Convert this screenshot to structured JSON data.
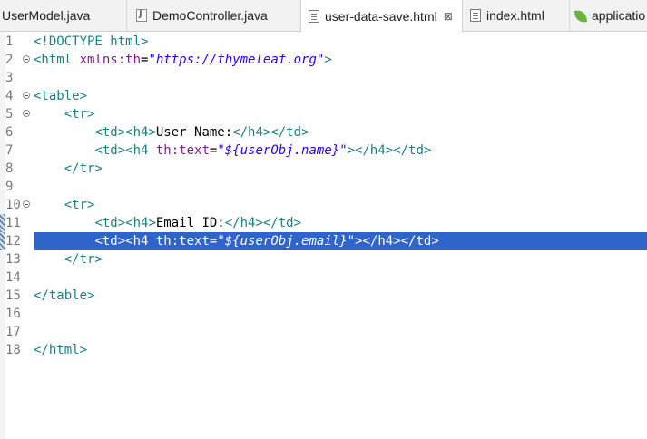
{
  "tabs": [
    {
      "label": "UserModel.java",
      "icon": "java-file-icon"
    },
    {
      "label": "DemoController.java",
      "icon": "java-file-icon"
    },
    {
      "label": "user-data-save.html",
      "icon": "html-file-icon",
      "active": true,
      "close": "⊠"
    },
    {
      "label": "index.html",
      "icon": "html-file-icon"
    },
    {
      "label": "applicatio",
      "icon": "spring-leaf-icon"
    }
  ],
  "editor": {
    "lines": [
      {
        "num": "1",
        "tokens": [
          [
            "tag",
            "<!DOCTYPE html>"
          ]
        ]
      },
      {
        "num": "2",
        "fold": true,
        "tokens": [
          [
            "tag",
            "<html "
          ],
          [
            "attr",
            "xmlns:th"
          ],
          [
            "txt",
            "="
          ],
          [
            "val",
            "\"https://thymeleaf.org\""
          ],
          [
            "tag",
            ">"
          ]
        ]
      },
      {
        "num": "3",
        "tokens": []
      },
      {
        "num": "4",
        "fold": true,
        "tokens": [
          [
            "tag",
            "<table>"
          ]
        ]
      },
      {
        "num": "5",
        "fold": true,
        "tokens": [
          [
            "txt",
            "    "
          ],
          [
            "tag",
            "<tr>"
          ]
        ]
      },
      {
        "num": "6",
        "tokens": [
          [
            "txt",
            "        "
          ],
          [
            "tag",
            "<td><h4>"
          ],
          [
            "txt",
            "User Name:"
          ],
          [
            "tag",
            "</h4></td>"
          ]
        ]
      },
      {
        "num": "7",
        "tokens": [
          [
            "txt",
            "        "
          ],
          [
            "tag",
            "<td><h4 "
          ],
          [
            "attr",
            "th:text"
          ],
          [
            "txt",
            "="
          ],
          [
            "val",
            "\"${userObj.name}\""
          ],
          [
            "tag",
            "></h4></td>"
          ]
        ]
      },
      {
        "num": "8",
        "tokens": [
          [
            "txt",
            "    "
          ],
          [
            "tag",
            "</tr>"
          ]
        ]
      },
      {
        "num": "9",
        "tokens": []
      },
      {
        "num": "10",
        "fold": true,
        "tokens": [
          [
            "txt",
            "    "
          ],
          [
            "tag",
            "<tr>"
          ]
        ]
      },
      {
        "num": "11",
        "marker": true,
        "tokens": [
          [
            "txt",
            "        "
          ],
          [
            "tag",
            "<td><h4>"
          ],
          [
            "txt",
            "Email ID:"
          ],
          [
            "tag",
            "</h4></td>"
          ]
        ]
      },
      {
        "num": "12",
        "marker": true,
        "selected": true,
        "tokens": [
          [
            "txt",
            "        "
          ],
          [
            "tag",
            "<td><h4 "
          ],
          [
            "attr",
            "th:text"
          ],
          [
            "txt",
            "="
          ],
          [
            "val",
            "\"${userObj.email}\""
          ],
          [
            "tag",
            "></h4></td>"
          ]
        ]
      },
      {
        "num": "13",
        "tokens": [
          [
            "txt",
            "    "
          ],
          [
            "tag",
            "</tr>"
          ]
        ]
      },
      {
        "num": "14",
        "tokens": []
      },
      {
        "num": "15",
        "tokens": [
          [
            "tag",
            "</table>"
          ]
        ]
      },
      {
        "num": "16",
        "tokens": []
      },
      {
        "num": "17",
        "tokens": []
      },
      {
        "num": "18",
        "tokens": [
          [
            "tag",
            "</html>"
          ]
        ]
      }
    ]
  }
}
